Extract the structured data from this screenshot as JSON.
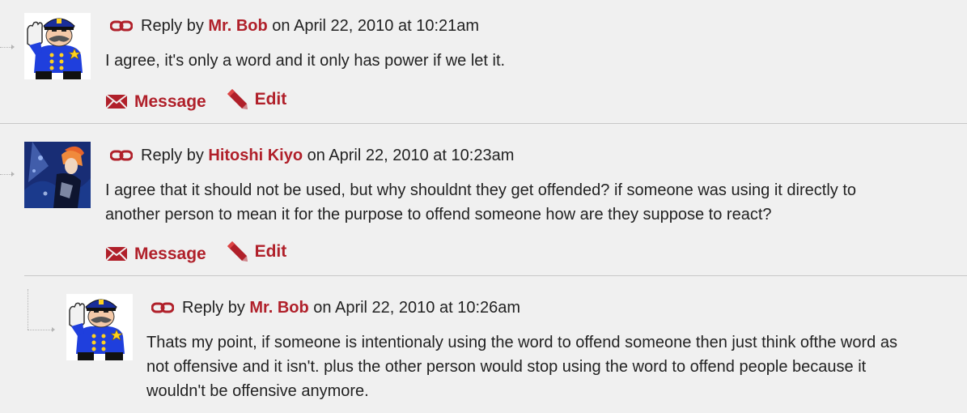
{
  "replies": [
    {
      "prefix": "Reply by",
      "author": "Mr. Bob",
      "date": "on April 22, 2010 at 10:21am",
      "text": "I agree, it's only a word and it only has power if we let it.",
      "actions": {
        "message": "Message",
        "edit": "Edit"
      }
    },
    {
      "prefix": "Reply by",
      "author": "Hitoshi Kiyo",
      "date": "on April 22, 2010 at 10:23am",
      "text_lines": [
        "I agree that it should not be used, but why shouldnt they get offended? if someone was using it directly to",
        "another person to mean it for the purpose to offend someone how are they suppose to react?"
      ],
      "actions": {
        "message": "Message",
        "edit": "Edit"
      }
    },
    {
      "prefix": "Reply by",
      "author": "Mr. Bob",
      "date": "on April 22, 2010 at 10:26am",
      "text_lines": [
        "Thats my point, if someone is intentionaly using the word to offend someone then just think ofthe word as",
        "not offensive and it isn't. plus the other person would stop using the word to offend people because it",
        "wouldn't be offensive anymore."
      ]
    }
  ],
  "icons": {
    "permalink": "chain-link-icon",
    "message": "envelope-icon",
    "edit": "pencil-icon"
  },
  "colors": {
    "accent": "#b0202a",
    "background": "#f0f0f0",
    "text": "#222222"
  }
}
